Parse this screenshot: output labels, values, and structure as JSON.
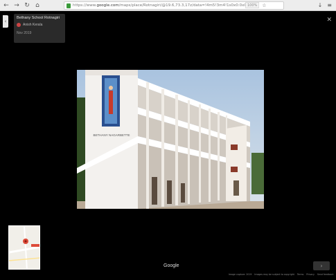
{
  "browser": {
    "url_prefix": "https://www.",
    "url_domain": "google.com",
    "url_rest": "/maps/place/Rotnagiri/@19.6,73.3,17z/data=!4m5!3m4!1s0x0:0x0",
    "zoom_chip": "100%",
    "icons": [
      "back-icon",
      "forward-icon",
      "reload-icon",
      "home-icon",
      "lock-icon",
      "star-icon",
      "menu-icon"
    ]
  },
  "info_card": {
    "title": "Bethany School Rotnagiri",
    "author": "Anish Kerala",
    "date": "Nov 2019"
  },
  "photo": {
    "building_sign": "BETHANY NAGARBETTE"
  },
  "google_label": "Google",
  "footer": {
    "items": [
      "Image capture: 2019",
      "Images may be subject to copyright",
      "Terms",
      "Privacy",
      "Send feedback"
    ]
  },
  "colors": {
    "background": "#000000",
    "card": "#2a2a2a",
    "accent_red": "#dd4b39"
  }
}
